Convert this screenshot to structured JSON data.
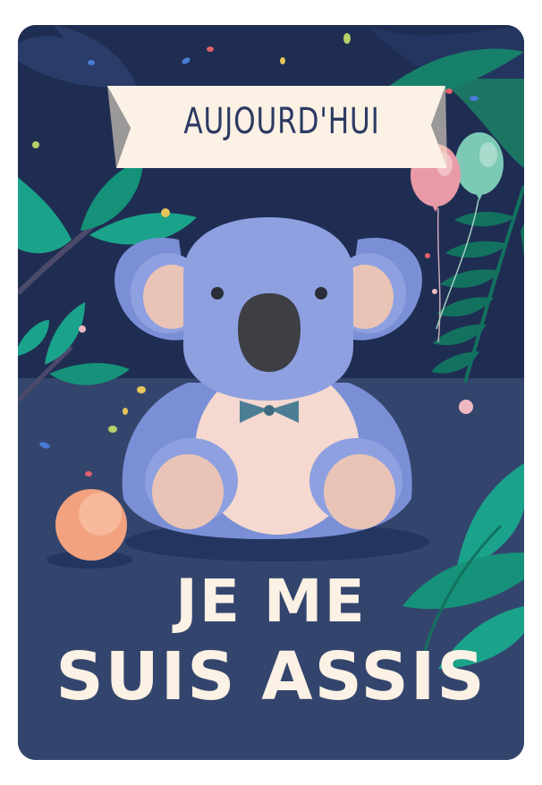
{
  "banner": {
    "text": "AUJOURD'HUI"
  },
  "headline": {
    "line1": "JE ME",
    "line2": "SUIS ASSIS"
  },
  "colors": {
    "background_top": "#1f2d52",
    "background_floor": "#34456d",
    "banner": "#fbf1e4",
    "banner_text": "#2c3a63",
    "koala_body": "#7b8fd6",
    "koala_light": "#8ea0e0",
    "koala_inner": "#f0d2c8",
    "nose": "#3d3f45",
    "bowtie": "#4b7e94",
    "leaf_teal": "#1aa38a",
    "leaf_dark": "#12725f",
    "balloon_pink": "#e89ba6",
    "balloon_mint": "#7cc9b5",
    "ball": "#f2a27f",
    "headline": "#fbf1e4"
  },
  "icons": [
    "koala-illustration",
    "balloon-icon",
    "ball-icon",
    "leaf-icon",
    "confetti-icon"
  ]
}
